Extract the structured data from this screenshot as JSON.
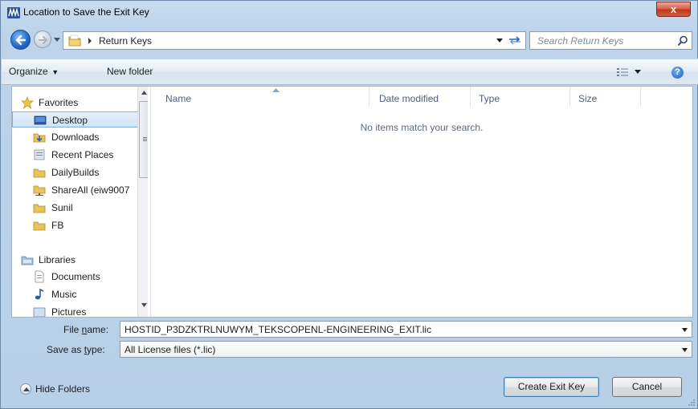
{
  "window": {
    "title": "Location to Save the Exit Key",
    "close_glyph": "x"
  },
  "address": {
    "breadcrumb": "Return Keys",
    "search_placeholder": "Search Return Keys"
  },
  "toolbar": {
    "organize_label": "Organize",
    "new_folder_label": "New folder",
    "help_glyph": "?"
  },
  "nav_pane": {
    "favorites_label": "Favorites",
    "favorites": [
      {
        "label": "Desktop",
        "icon": "desktop-icon",
        "selected": true
      },
      {
        "label": "Downloads",
        "icon": "downloads-folder-icon"
      },
      {
        "label": "Recent Places",
        "icon": "recent-places-icon"
      },
      {
        "label": "DailyBuilds",
        "icon": "folder-icon"
      },
      {
        "label": "ShareAll (eiw9007",
        "icon": "network-folder-icon"
      },
      {
        "label": "Sunil",
        "icon": "folder-icon"
      },
      {
        "label": "FB",
        "icon": "folder-icon"
      }
    ],
    "libraries_label": "Libraries",
    "libraries": [
      {
        "label": "Documents",
        "icon": "documents-icon"
      },
      {
        "label": "Music",
        "icon": "music-icon"
      },
      {
        "label": "Pictures",
        "icon": "pictures-icon"
      }
    ]
  },
  "columns": {
    "name": "Name",
    "date_modified": "Date modified",
    "type": "Type",
    "size": "Size"
  },
  "empty_message": "No items match your search.",
  "file_name": {
    "label_prefix": "File ",
    "label_underlined": "n",
    "label_suffix": "ame:",
    "value": "HOSTID_P3DZKTRLNUWYM_TEKSCOPENL-ENGINEERING_EXIT.lic"
  },
  "save_as_type": {
    "label_prefix": "Save as ",
    "label_underlined": "t",
    "label_suffix": "ype:",
    "value": "All License files (*.lic)"
  },
  "footer": {
    "hide_folders_label": "Hide Folders",
    "primary_button": "Create Exit Key",
    "cancel_button": "Cancel"
  },
  "colors": {
    "frame": "#bcd3ea",
    "selection": "#cfe3f8",
    "close_button": "#c1371b",
    "folder": "#e8c25a"
  }
}
